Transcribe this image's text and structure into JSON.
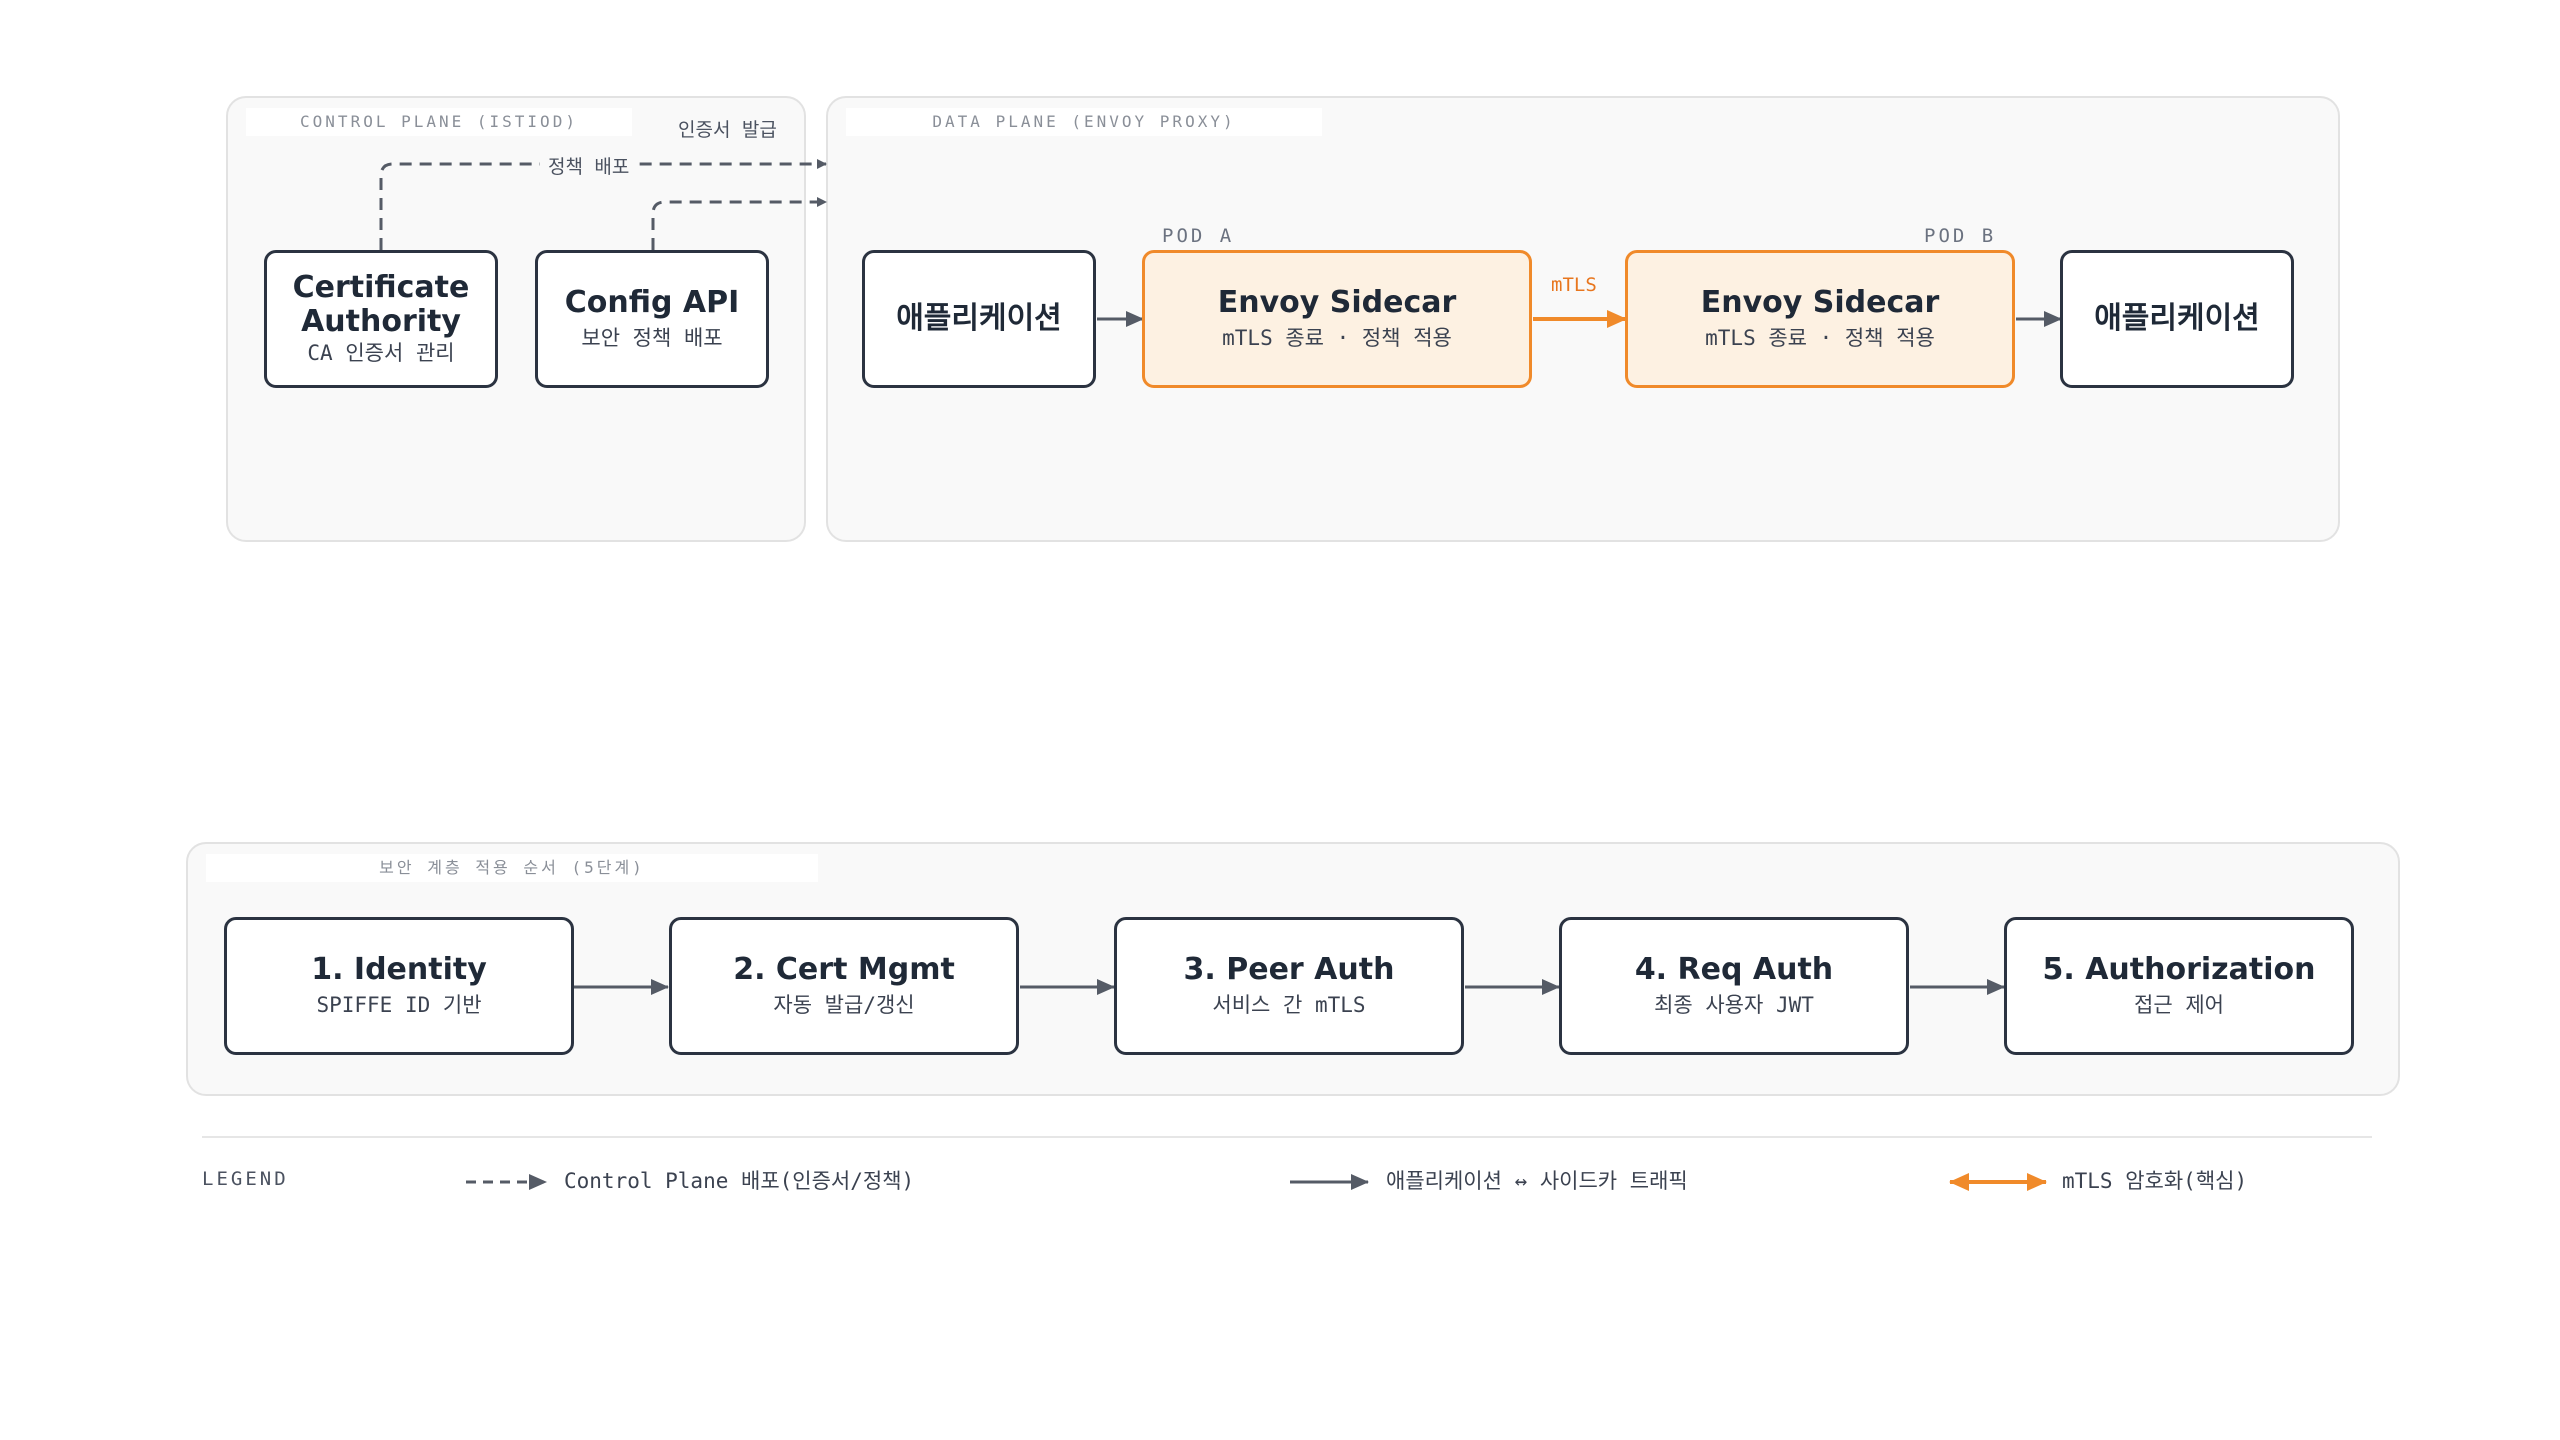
{
  "control_plane": {
    "title": "CONTROL PLANE (ISTIOD)",
    "ca": {
      "title": "Certificate\nAuthority",
      "subtitle": "CA 인증서 관리"
    },
    "config": {
      "title": "Config API",
      "subtitle": "보안 정책 배포"
    },
    "label_cert": "인증서 발급",
    "label_policy": "정책 배포"
  },
  "data_plane": {
    "title": "DATA PLANE (ENVOY PROXY)",
    "pod_a": "POD A",
    "pod_b": "POD B",
    "app_left": "애플리케이션",
    "app_right": "애플리케이션",
    "sidecar_a": {
      "title": "Envoy Sidecar",
      "subtitle": "mTLS 종료 · 정책 적용"
    },
    "sidecar_b": {
      "title": "Envoy Sidecar",
      "subtitle": "mTLS 종료 · 정책 적용"
    },
    "mtls_label": "mTLS"
  },
  "layers": {
    "title": "보안 계층 적용 순서 (5단계)",
    "steps": [
      {
        "title": "1. Identity",
        "subtitle": "SPIFFE ID 기반"
      },
      {
        "title": "2. Cert Mgmt",
        "subtitle": "자동 발급/갱신"
      },
      {
        "title": "3. Peer Auth",
        "subtitle": "서비스 간 mTLS"
      },
      {
        "title": "4. Req Auth",
        "subtitle": "최종 사용자 JWT"
      },
      {
        "title": "5. Authorization",
        "subtitle": "접근 제어"
      }
    ]
  },
  "legend": {
    "title": "LEGEND",
    "items": [
      {
        "style": "dashed",
        "label": "Control Plane 배포(인증서/정책)"
      },
      {
        "style": "solid",
        "label": "애플리케이션 ↔ 사이드카 트래픽"
      },
      {
        "style": "accent",
        "label": "mTLS 암호화(핵심)"
      }
    ]
  },
  "colors": {
    "stroke": "#2b3341",
    "connector": "#555b66",
    "accent": "#f08a2a",
    "accent_fill": "#fdf1e2",
    "panel_fill": "#f9f9f9"
  }
}
